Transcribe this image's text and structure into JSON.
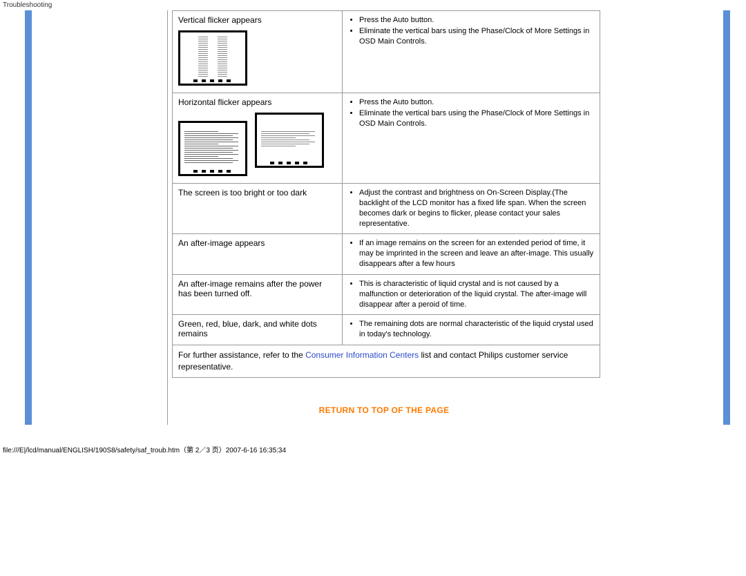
{
  "header": {
    "label": "Troubleshooting"
  },
  "rows": [
    {
      "title": "Vertical flicker appears",
      "solutions": [
        "Press the Auto button.",
        "Eliminate the vertical bars using the Phase/Clock of More Settings in OSD Main Controls."
      ]
    },
    {
      "title": "Horizontal flicker appears",
      "solutions": [
        "Press the Auto button.",
        "Eliminate the vertical bars using the Phase/Clock of More Settings in OSD Main Controls."
      ]
    },
    {
      "title": "The screen is too bright or too dark",
      "solutions": [
        "Adjust the contrast and brightness on On-Screen Display.(The backlight of the LCD monitor has a fixed life span. When the screen becomes dark or begins to flicker, please contact your sales representative."
      ]
    },
    {
      "title": "An after-image appears",
      "solutions": [
        "If an image remains on the screen for an extended period of time, it may be imprinted in the screen and leave an after-image. This usually disappears after a few hours"
      ]
    },
    {
      "title": "An after-image remains after the power has been turned off.",
      "solutions": [
        "This is characteristic of liquid crystal and is not caused by a malfunction or deterioration of the liquid crystal. The after-image will disappear after a peroid of time."
      ]
    },
    {
      "title": "Green, red, blue, dark, and white dots remains",
      "solutions": [
        "The remaining dots are normal characteristic of the liquid crystal used in today's technology."
      ]
    }
  ],
  "footnote": {
    "prefix": "For further assistance, refer to the ",
    "link": "Consumer Information Centers",
    "suffix": " list and contact Philips customer service representative."
  },
  "return_link": "RETURN TO TOP OF THE PAGE",
  "footer_path": "file:///E|/lcd/manual/ENGLISH/190S8/safety/saf_troub.htm（第 2／3 页）2007-6-16 16:35:34"
}
